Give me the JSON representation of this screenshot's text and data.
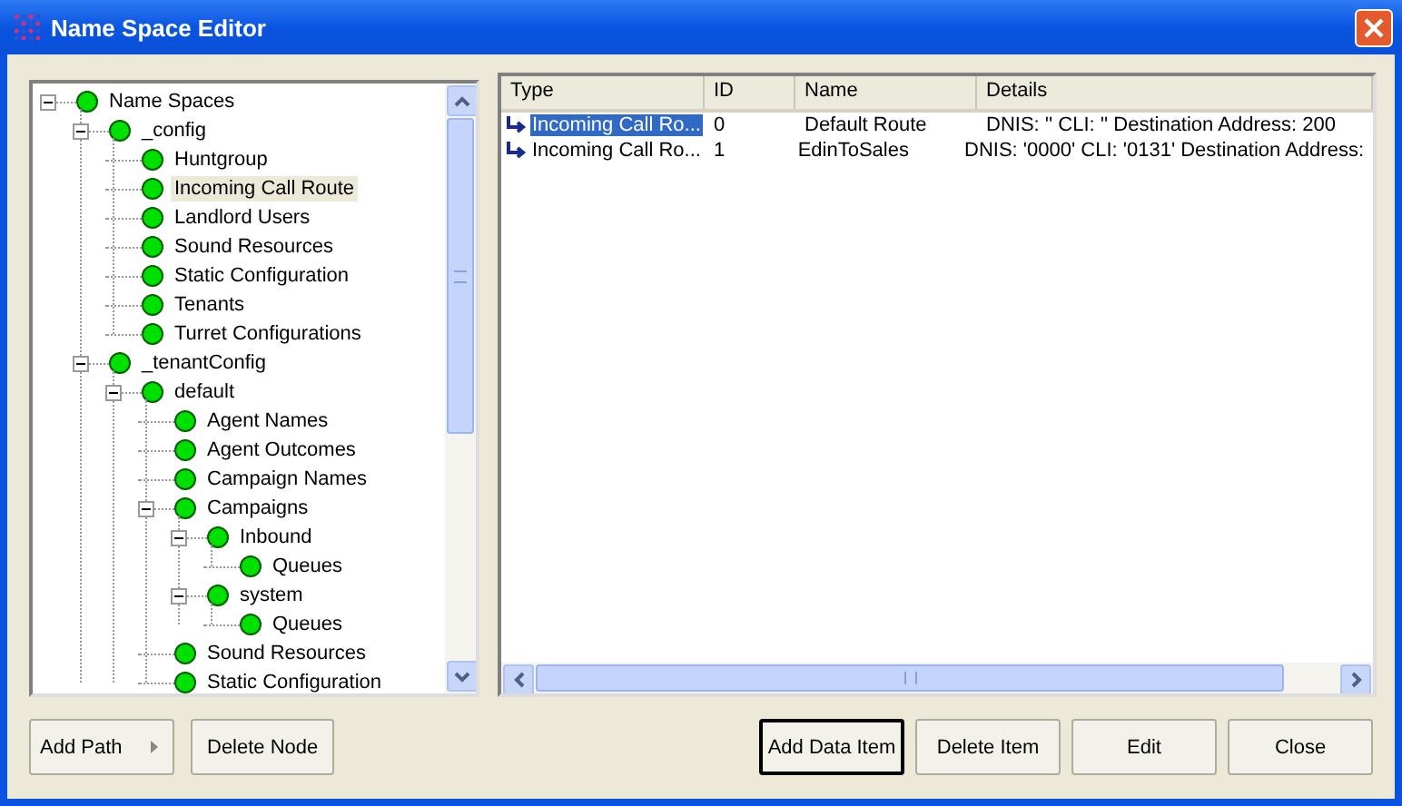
{
  "window": {
    "title": "Name Space Editor"
  },
  "tree": [
    {
      "label": "Name Spaces",
      "selected": false,
      "expanded": true,
      "children": [
        {
          "label": "_config",
          "selected": false,
          "expanded": true,
          "children": [
            {
              "label": "Huntgroup",
              "selected": false
            },
            {
              "label": "Incoming Call Route",
              "selected": true
            },
            {
              "label": "Landlord Users",
              "selected": false
            },
            {
              "label": "Sound Resources",
              "selected": false
            },
            {
              "label": "Static Configuration",
              "selected": false
            },
            {
              "label": "Tenants",
              "selected": false
            },
            {
              "label": "Turret Configurations",
              "selected": false
            }
          ]
        },
        {
          "label": "_tenantConfig",
          "selected": false,
          "expanded": true,
          "children": [
            {
              "label": "default",
              "selected": false,
              "expanded": true,
              "children": [
                {
                  "label": "Agent Names",
                  "selected": false
                },
                {
                  "label": "Agent Outcomes",
                  "selected": false
                },
                {
                  "label": "Campaign Names",
                  "selected": false
                },
                {
                  "label": "Campaigns",
                  "selected": false,
                  "expanded": true,
                  "children": [
                    {
                      "label": "Inbound",
                      "selected": false,
                      "expanded": true,
                      "children": [
                        {
                          "label": "Queues",
                          "selected": false
                        }
                      ]
                    },
                    {
                      "label": "system",
                      "selected": false,
                      "expanded": true,
                      "children": [
                        {
                          "label": "Queues",
                          "selected": false
                        }
                      ]
                    }
                  ]
                },
                {
                  "label": "Sound Resources",
                  "selected": false
                },
                {
                  "label": "Static Configuration",
                  "selected": false
                }
              ]
            }
          ]
        }
      ]
    }
  ],
  "table": {
    "columns": [
      "Type",
      "ID",
      "Name",
      "Details"
    ],
    "rows": [
      {
        "cells": [
          "Incoming Call Ro...",
          "0",
          "Default Route",
          "DNIS: '' CLI: '' Destination Address: 200"
        ],
        "selected": true
      },
      {
        "cells": [
          "Incoming Call Ro...",
          "1",
          "EdinToSales",
          "DNIS: '0000' CLI: '0131' Destination Address:"
        ],
        "selected": false
      }
    ]
  },
  "left_buttons": [
    {
      "label": "Add Path",
      "kind": "menu"
    },
    {
      "label": "Delete Node",
      "kind": "plain"
    }
  ],
  "right_buttons": [
    {
      "label": "Add Data Item",
      "default": true
    },
    {
      "label": "Delete Item",
      "default": false
    },
    {
      "label": "Edit",
      "default": false
    },
    {
      "label": "Close",
      "default": false
    }
  ]
}
